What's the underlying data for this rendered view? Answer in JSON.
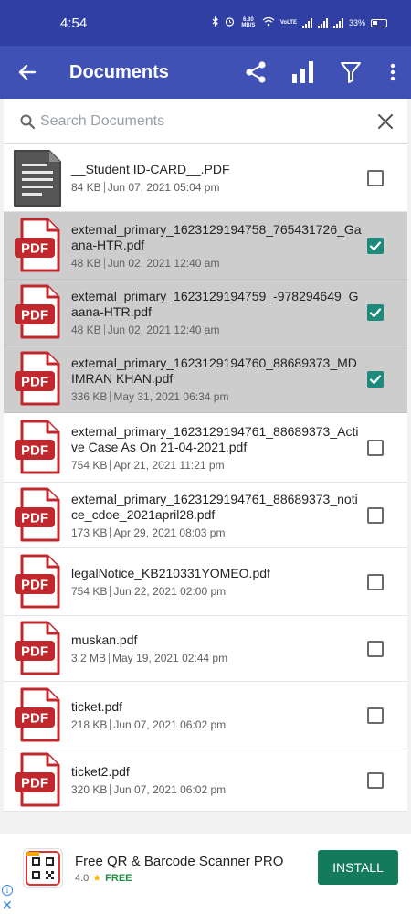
{
  "status": {
    "time": "4:54",
    "speed": "6.30 MB/S",
    "battery": "33%"
  },
  "appbar": {
    "title": "Documents",
    "icons": [
      "back-arrow-icon",
      "share-icon",
      "bar-chart-icon",
      "filter-icon",
      "more-vert-icon"
    ]
  },
  "search": {
    "placeholder": "Search Documents"
  },
  "files": [
    {
      "name": "__Student ID-CARD__.PDF",
      "size": "84 KB",
      "date": "Jun 07, 2021 05:04 pm",
      "type": "doc",
      "selected": false
    },
    {
      "name": "external_primary_1623129194758_765431726_Gaana-HTR.pdf",
      "size": "48 KB",
      "date": "Jun 02, 2021 12:40 am",
      "type": "pdf",
      "selected": true
    },
    {
      "name": "external_primary_1623129194759_-978294649_Gaana-HTR.pdf",
      "size": "48 KB",
      "date": "Jun 02, 2021 12:40 am",
      "type": "pdf",
      "selected": true
    },
    {
      "name": "external_primary_1623129194760_88689373_MD IMRAN KHAN.pdf",
      "size": "336 KB",
      "date": "May 31, 2021 06:34 pm",
      "type": "pdf",
      "selected": true
    },
    {
      "name": "external_primary_1623129194761_88689373_Active Case As On 21-04-2021.pdf",
      "size": "754 KB",
      "date": "Apr 21, 2021 11:21 pm",
      "type": "pdf",
      "selected": false
    },
    {
      "name": "external_primary_1623129194761_88689373_notice_cdoe_2021april28.pdf",
      "size": "173 KB",
      "date": "Apr 29, 2021 08:03 pm",
      "type": "pdf",
      "selected": false
    },
    {
      "name": "legalNotice_KB210331YOMEO.pdf",
      "size": "754 KB",
      "date": "Jun 22, 2021 02:00 pm",
      "type": "pdf",
      "selected": false
    },
    {
      "name": "muskan.pdf",
      "size": "3.2 MB",
      "date": "May 19, 2021 02:44 pm",
      "type": "pdf",
      "selected": false
    },
    {
      "name": "ticket.pdf",
      "size": "218 KB",
      "date": "Jun 07, 2021 06:02 pm",
      "type": "pdf",
      "selected": false
    },
    {
      "name": "ticket2.pdf",
      "size": "320 KB",
      "date": "Jun 07, 2021 06:02 pm",
      "type": "pdf",
      "selected": false
    }
  ],
  "pdf_badge": "PDF",
  "ad": {
    "title": "Free QR & Barcode Scanner PRO",
    "rating": "4.0",
    "star": "★",
    "price": "FREE",
    "install_label": "INSTALL"
  },
  "colors": {
    "status_bar": "#2f3fa3",
    "app_bar": "#3f51b5",
    "selected_row": "#cdcdcd",
    "checkbox_checked": "#1d8a7c",
    "pdf_red": "#c0282d",
    "install_button": "#137a5b"
  }
}
